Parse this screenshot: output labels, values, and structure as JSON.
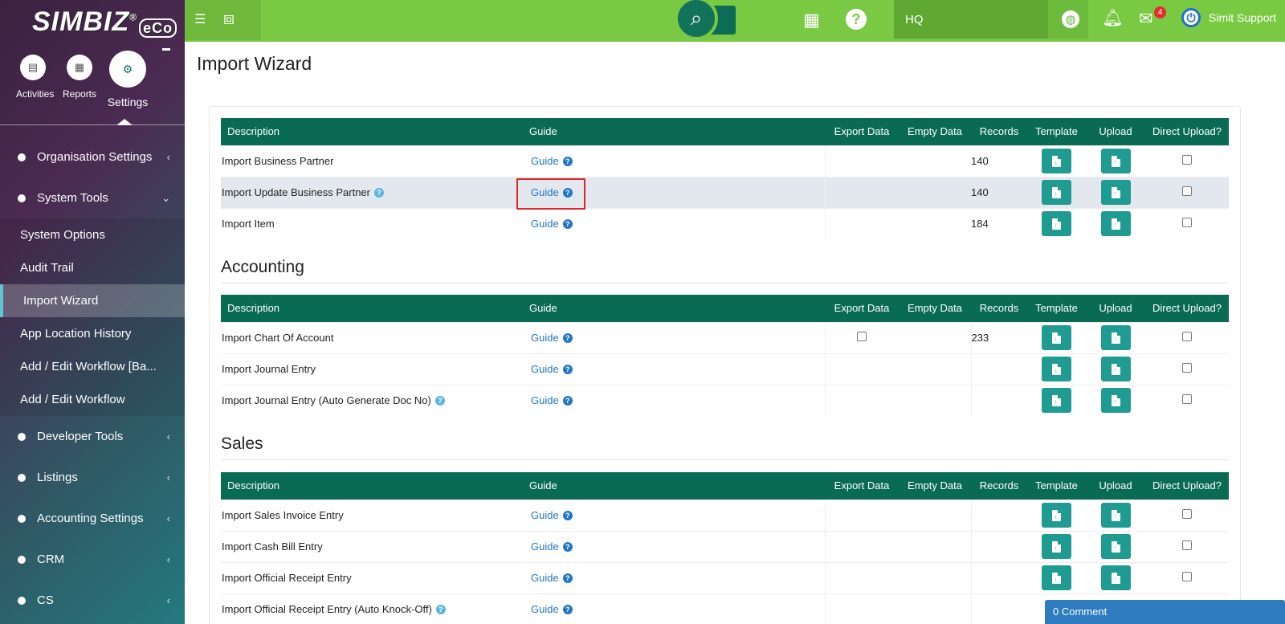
{
  "brand": {
    "name": "SIMBIZ",
    "reg": "®",
    "eco": "eCo"
  },
  "quick": [
    {
      "label": "Activities",
      "icon": "doc-icon"
    },
    {
      "label": "Reports",
      "icon": "report-icon"
    },
    {
      "label": "Settings",
      "icon": "gear-icon"
    }
  ],
  "sidebar": {
    "items": [
      {
        "label": "Organisation Settings"
      },
      {
        "label": "System Tools"
      },
      {
        "label": "Developer Tools"
      },
      {
        "label": "Listings"
      },
      {
        "label": "Accounting Settings"
      },
      {
        "label": "CRM"
      },
      {
        "label": "CS"
      }
    ],
    "sub": [
      {
        "label": "System Options"
      },
      {
        "label": "Audit Trail"
      },
      {
        "label": "Import Wizard"
      },
      {
        "label": "App Location History"
      },
      {
        "label": "Add / Edit Workflow [Ba..."
      },
      {
        "label": "Add / Edit Workflow"
      }
    ]
  },
  "topbar": {
    "hq": "HQ",
    "mail_count": "4",
    "user": "Simit Support"
  },
  "page_title": "Import Wizard",
  "headers": {
    "description": "Description",
    "guide": "Guide",
    "export": "Export Data",
    "empty": "Empty Data",
    "records": "Records",
    "template": "Template",
    "upload": "Upload",
    "direct": "Direct Upload?"
  },
  "sections": {
    "general": {
      "rows": [
        {
          "desc": "Import Business Partner",
          "guide": "Guide",
          "records": "140"
        },
        {
          "desc": "Import Update Business Partner",
          "guide": "Guide",
          "records": "140"
        },
        {
          "desc": "Import Item",
          "guide": "Guide",
          "records": "184"
        }
      ]
    },
    "accounting": {
      "title": "Accounting",
      "rows": [
        {
          "desc": "Import Chart Of Account",
          "guide": "Guide",
          "records": "233"
        },
        {
          "desc": "Import Journal Entry",
          "guide": "Guide",
          "records": ""
        },
        {
          "desc": "Import Journal Entry (Auto Generate Doc No)",
          "guide": "Guide",
          "records": ""
        }
      ]
    },
    "sales": {
      "title": "Sales",
      "rows": [
        {
          "desc": "Import Sales Invoice Entry",
          "guide": "Guide",
          "records": ""
        },
        {
          "desc": "Import Cash Bill Entry",
          "guide": "Guide",
          "records": ""
        },
        {
          "desc": "Import Official Receipt Entry",
          "guide": "Guide",
          "records": ""
        },
        {
          "desc": "Import Official Receipt Entry (Auto Knock-Off)",
          "guide": "Guide",
          "records": ""
        }
      ]
    }
  },
  "comment_bar": "0 Comment"
}
